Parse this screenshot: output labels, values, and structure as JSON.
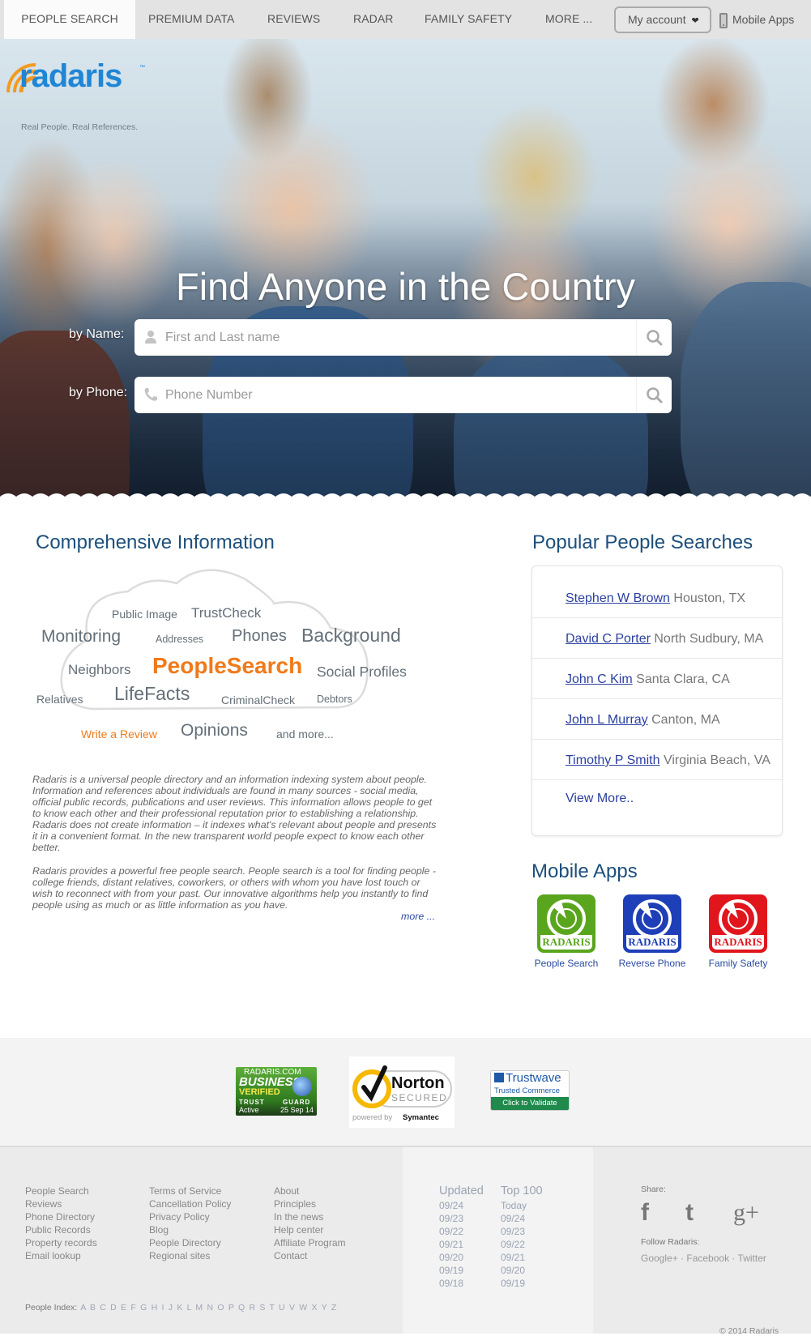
{
  "nav": {
    "items": [
      {
        "label": "PEOPLE SEARCH",
        "active": true
      },
      {
        "label": "PREMIUM DATA",
        "active": false
      },
      {
        "label": "REVIEWS",
        "active": false
      },
      {
        "label": "RADAR",
        "active": false
      },
      {
        "label": "FAMILY SAFETY",
        "active": false
      },
      {
        "label": "MORE ...",
        "active": false
      }
    ],
    "account_label": "My account",
    "account_icon": "chevron-down-icon",
    "mobile_apps_label": "Mobile Apps",
    "mobile_apps_icon": "mobile-phone-icon"
  },
  "brand": {
    "logo_text": "radaris",
    "trademark": "™",
    "tagline": "Real People. Real References.",
    "logo_color": "#1f86d6",
    "arc_color": "#f39a1e"
  },
  "hero": {
    "title": "Find Anyone in the Country",
    "name_search": {
      "label": "by Name:",
      "placeholder": "First and Last name",
      "value": "",
      "icon": "person-icon"
    },
    "phone_search": {
      "label": "by Phone:",
      "placeholder": "Phone Number",
      "value": "",
      "icon": "phone-icon"
    },
    "search_icon": "search-icon"
  },
  "comprehensive": {
    "heading": "Comprehensive Information",
    "tags": [
      {
        "text": "Public Image"
      },
      {
        "text": "TrustCheck"
      },
      {
        "text": "Monitoring"
      },
      {
        "text": "Addresses"
      },
      {
        "text": "Phones"
      },
      {
        "text": "Background"
      },
      {
        "text": "Neighbors"
      },
      {
        "text": "PeopleSearch"
      },
      {
        "text": "Social Profiles"
      },
      {
        "text": "Relatives"
      },
      {
        "text": "LifeFacts"
      },
      {
        "text": "CriminalCheck"
      },
      {
        "text": "Debtors"
      },
      {
        "text": "Write a Review"
      },
      {
        "text": "Opinions"
      },
      {
        "text": "and more..."
      }
    ],
    "paragraphs": [
      "Radaris is a universal people directory and an information indexing system about people. Information and references about individuals are found in many sources - social media, official public records, publications and user reviews. This information allows people to get to know each other and their professional reputation prior to establishing a relationship. Radaris does not create information – it indexes what's relevant about people and presents it in a convenient format. In the new transparent world people expect to know each other better.",
      "Radaris provides a powerful free people search. People search is a tool for finding people - college friends, distant relatives, coworkers, or others with whom you have lost touch or wish to reconnect with from your past. Our innovative algorithms help you instantly to find people using as much or as little information as you have."
    ],
    "more_label": "more ..."
  },
  "popular": {
    "heading": "Popular People Searches",
    "items": [
      {
        "name": "Stephen W Brown",
        "location": "Houston, TX"
      },
      {
        "name": "David C Porter",
        "location": "North Sudbury, MA"
      },
      {
        "name": "John C Kim",
        "location": "Santa Clara, CA"
      },
      {
        "name": "John L Murray",
        "location": "Canton, MA"
      },
      {
        "name": "Timothy P Smith",
        "location": "Virginia Beach, VA"
      }
    ],
    "view_more": "View More.."
  },
  "mobile_apps": {
    "heading": "Mobile Apps",
    "apps": [
      {
        "label": "People Search",
        "badge": "RADARIS",
        "color": "#5aa51e"
      },
      {
        "label": "Reverse Phone",
        "badge": "RADARIS",
        "color": "#1f3fb8"
      },
      {
        "label": "Family Safety",
        "badge": "RADARIS",
        "color": "#e0161c"
      }
    ]
  },
  "trust_badges": {
    "trustguard": {
      "site": "RADARIS.COM",
      "line1": "BUSINESS",
      "line2": "VERIFIED",
      "trust": "TRUST",
      "guard": "GUARD",
      "status": "Active",
      "date": "25 Sep 14"
    },
    "norton": {
      "name": "Norton",
      "secured": "SECURED",
      "powered": "powered by",
      "by": "Symantec"
    },
    "trustwave": {
      "name": "Trustwave",
      "sub": "Trusted Commerce",
      "cta": "Click to Validate"
    }
  },
  "footer": {
    "col1": [
      "People Search",
      "Reviews",
      "Phone Directory",
      "Public Records",
      "Property records",
      "Email lookup"
    ],
    "col2": [
      "Terms of Service",
      "Cancellation Policy",
      "Privacy Policy",
      "Blog",
      "People Directory",
      "Regional sites"
    ],
    "col3": [
      "About",
      "Principles",
      "In the news",
      "Help center",
      "Affiliate Program",
      "Contact"
    ],
    "updated": {
      "heading": "Updated",
      "dates": [
        "09/24",
        "09/23",
        "09/22",
        "09/21",
        "09/20",
        "09/19",
        "09/18"
      ]
    },
    "top100": {
      "heading": "Top 100",
      "dates": [
        "Today",
        "09/24",
        "09/23",
        "09/22",
        "09/21",
        "09/20",
        "09/19"
      ]
    },
    "share_label": "Share:",
    "share_icons": [
      "facebook-icon",
      "twitter-icon",
      "google-plus-icon"
    ],
    "follow_label": "Follow Radaris:",
    "follow_links": [
      "Google+",
      "Facebook",
      "Twitter"
    ],
    "people_index_label": "People Index:",
    "people_index_letters": "A B C D E F G H I J K L M N O P Q R S T U V W X Y Z",
    "copyright": "© 2014 Radaris"
  }
}
